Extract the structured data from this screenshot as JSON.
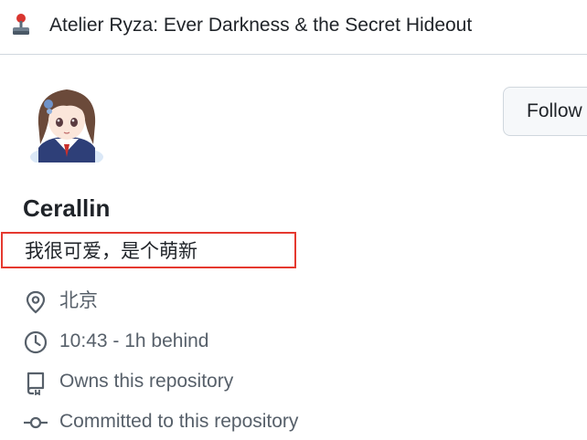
{
  "header": {
    "title": "Atelier Ryza: Ever Darkness & the Secret Hideout",
    "icon": "joystick-icon"
  },
  "profile": {
    "name": "Cerallin",
    "bio": "我很可爱，是个萌新",
    "follow_label": "Follow",
    "details": {
      "location": "北京",
      "local_time": "10:43 - 1h behind",
      "repository_owner": "Owns this repository",
      "committed": "Committed to this repository"
    }
  },
  "colors": {
    "highlight_border": "#e5392f",
    "muted_text": "#57606a",
    "joystick_red": "#d9352f"
  }
}
